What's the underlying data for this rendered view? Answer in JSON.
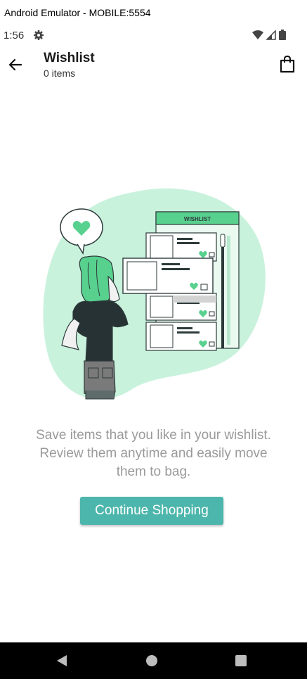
{
  "window": {
    "title": "Android Emulator - MOBILE:5554"
  },
  "status": {
    "time": "1:56"
  },
  "app_bar": {
    "title": "Wishlist",
    "subtitle": "0 items"
  },
  "illustration": {
    "board_label": "WISHLIST"
  },
  "empty_state": {
    "message_line1": "Save items that you like in your wishlist.",
    "message_line2": "Review them anytime and easily move",
    "message_line3": "them to bag.",
    "button_label": "Continue Shopping"
  },
  "colors": {
    "accent": "#4db6ac",
    "mint": "#c9f2dd",
    "illustration_green": "#58d18f"
  },
  "icons": [
    "gear-icon",
    "wifi-icon",
    "signal-icon",
    "battery-icon",
    "back-arrow-icon",
    "shopping-bag-icon",
    "heart-icon",
    "cart-icon",
    "nav-back-icon",
    "nav-home-icon",
    "nav-recents-icon"
  ]
}
